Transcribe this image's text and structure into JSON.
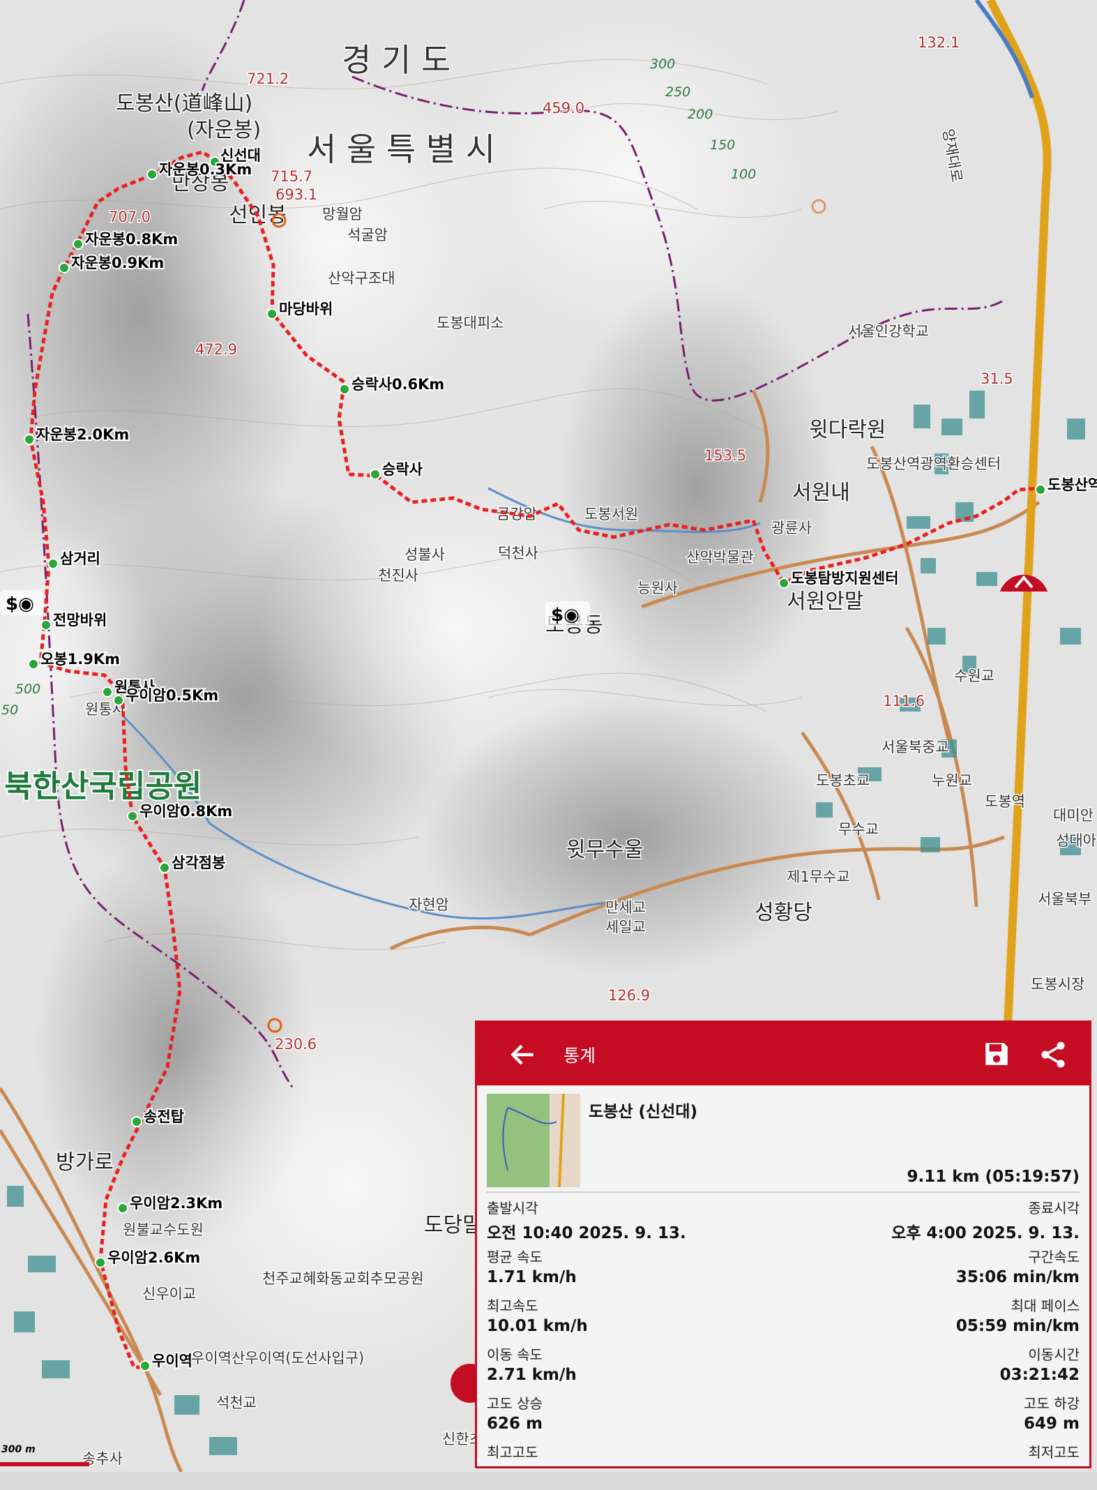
{
  "map": {
    "province_labels": [
      "경 기 도",
      "서 울 특 별 시"
    ],
    "park_label": "북한산국립공원",
    "mountain_name": "도봉산(道峰山)",
    "mountain_subname": "(자운봉)",
    "places": [
      "만장봉",
      "선인봉",
      "망월암",
      "석굴암",
      "산악구조대",
      "도봉대피소",
      "윗다락원",
      "서원내",
      "서원안말",
      "도봉서원",
      "광륜사",
      "금강암",
      "덕천사",
      "성불사",
      "천진사",
      "산악박물관",
      "능원사",
      "도봉동",
      "서울인강학교",
      "도봉산역광역환승센터",
      "서울북중교",
      "도봉초교",
      "누원교",
      "수원교",
      "도봉역",
      "무수교",
      "제1무수교",
      "윗무수울",
      "만세교",
      "세일교",
      "성황당",
      "자현암",
      "방가로",
      "원불교수도원",
      "신우이교",
      "천주교혜화동교회추모공원",
      "도당말",
      "석천교",
      "신한초교",
      "송추사",
      "원통사",
      "도봉시장",
      "서울북부",
      "성대아",
      "대미안"
    ],
    "peaks": [
      "721.2",
      "715.7",
      "693.1",
      "707.0",
      "472.9",
      "459.0",
      "132.1",
      "153.5",
      "111.6",
      "126.9",
      "230.6",
      "31.5"
    ],
    "contour_labels": [
      "300",
      "250",
      "200",
      "150",
      "100",
      "500",
      "50"
    ],
    "road_label": "양재대로",
    "waypoints": [
      "신선대",
      "자운봉0.3Km",
      "자운봉0.8Km",
      "자운봉0.9Km",
      "마당바위",
      "승락사0.6Km",
      "자운봉2.0Km",
      "승락사",
      "삼거리",
      "전망바위",
      "오봉1.9Km",
      "원통사",
      "우이암0.5Km",
      "우이암0.8Km",
      "삼각점봉",
      "송전탑",
      "우이암2.3Km",
      "우이암2.6Km",
      "우이역",
      "도봉탐방지원센터",
      "도봉산역"
    ],
    "trailhead_label": "우이역산우이역(도선사입구)",
    "scale": "300 m"
  },
  "stats_panel": {
    "title": "통계",
    "track_name": "도봉산 (신선대)",
    "total": "9.11 km (05:19:57)",
    "rows": [
      {
        "left_label": "출발시각",
        "left_value": "오전 10:40 2025. 9. 13.",
        "right_label": "종료시각",
        "right_value": "오후 4:00 2025. 9. 13."
      },
      {
        "left_label": "평균 속도",
        "left_value": "1.71 km/h",
        "right_label": "구간속도",
        "right_value": "35:06 min/km"
      },
      {
        "left_label": "최고속도",
        "left_value": "10.01 km/h",
        "right_label": "최대 페이스",
        "right_value": "05:59 min/km"
      },
      {
        "left_label": "이동 속도",
        "left_value": "2.71 km/h",
        "right_label": "이동시간",
        "right_value": "03:21:42"
      },
      {
        "left_label": "고도 상승",
        "left_value": "626 m",
        "right_label": "고도 하강",
        "right_value": "649 m"
      },
      {
        "left_label": "최고고도",
        "left_value": "",
        "right_label": "최저고도",
        "right_value": ""
      }
    ]
  },
  "colors": {
    "accent": "#c40d23",
    "route": "#e8201f",
    "waypoint": "#2aa63a",
    "road": "#c98a52",
    "highway": "#e0a21a",
    "water": "#5b8fc6",
    "boundary": "#7a1f6e"
  }
}
